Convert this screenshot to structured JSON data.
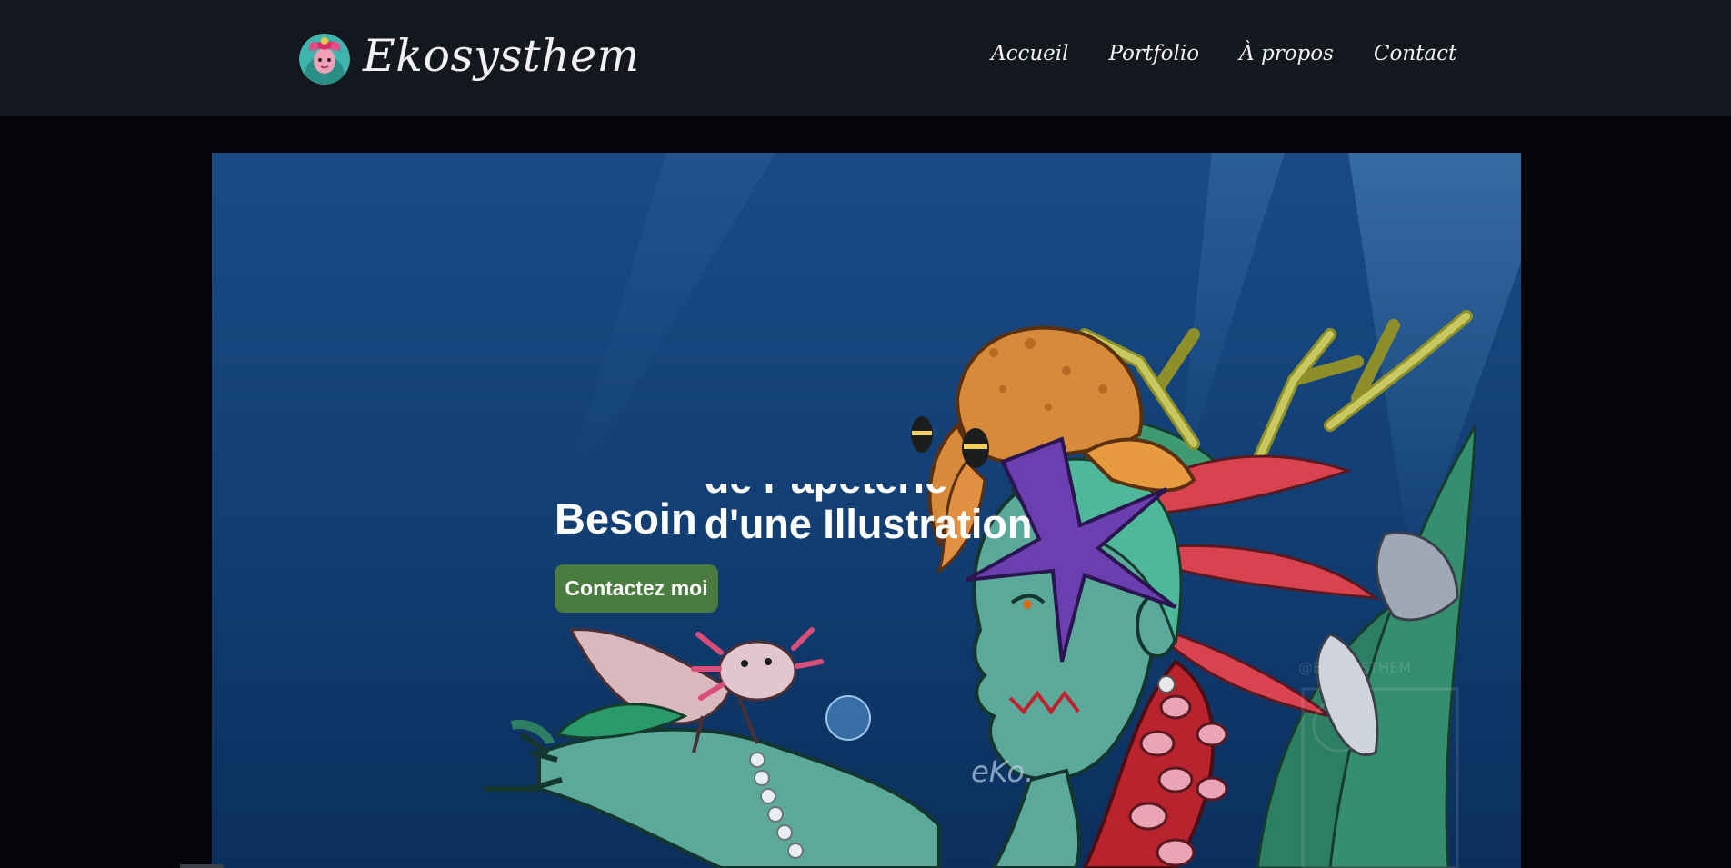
{
  "header": {
    "brand": "Ekosysthem",
    "nav": [
      {
        "label": "Accueil"
      },
      {
        "label": "Portfolio"
      },
      {
        "label": "À propos"
      },
      {
        "label": "Contact"
      }
    ]
  },
  "hero": {
    "headline_word": "Besoin",
    "rotating_lines": [
      "de Papeterie",
      "d'une Illustration"
    ],
    "cta_label": "Contactez moi"
  },
  "colors": {
    "header_bg": "#14171d",
    "page_bg": "#030508",
    "cta_bg": "#4a7c3f"
  }
}
